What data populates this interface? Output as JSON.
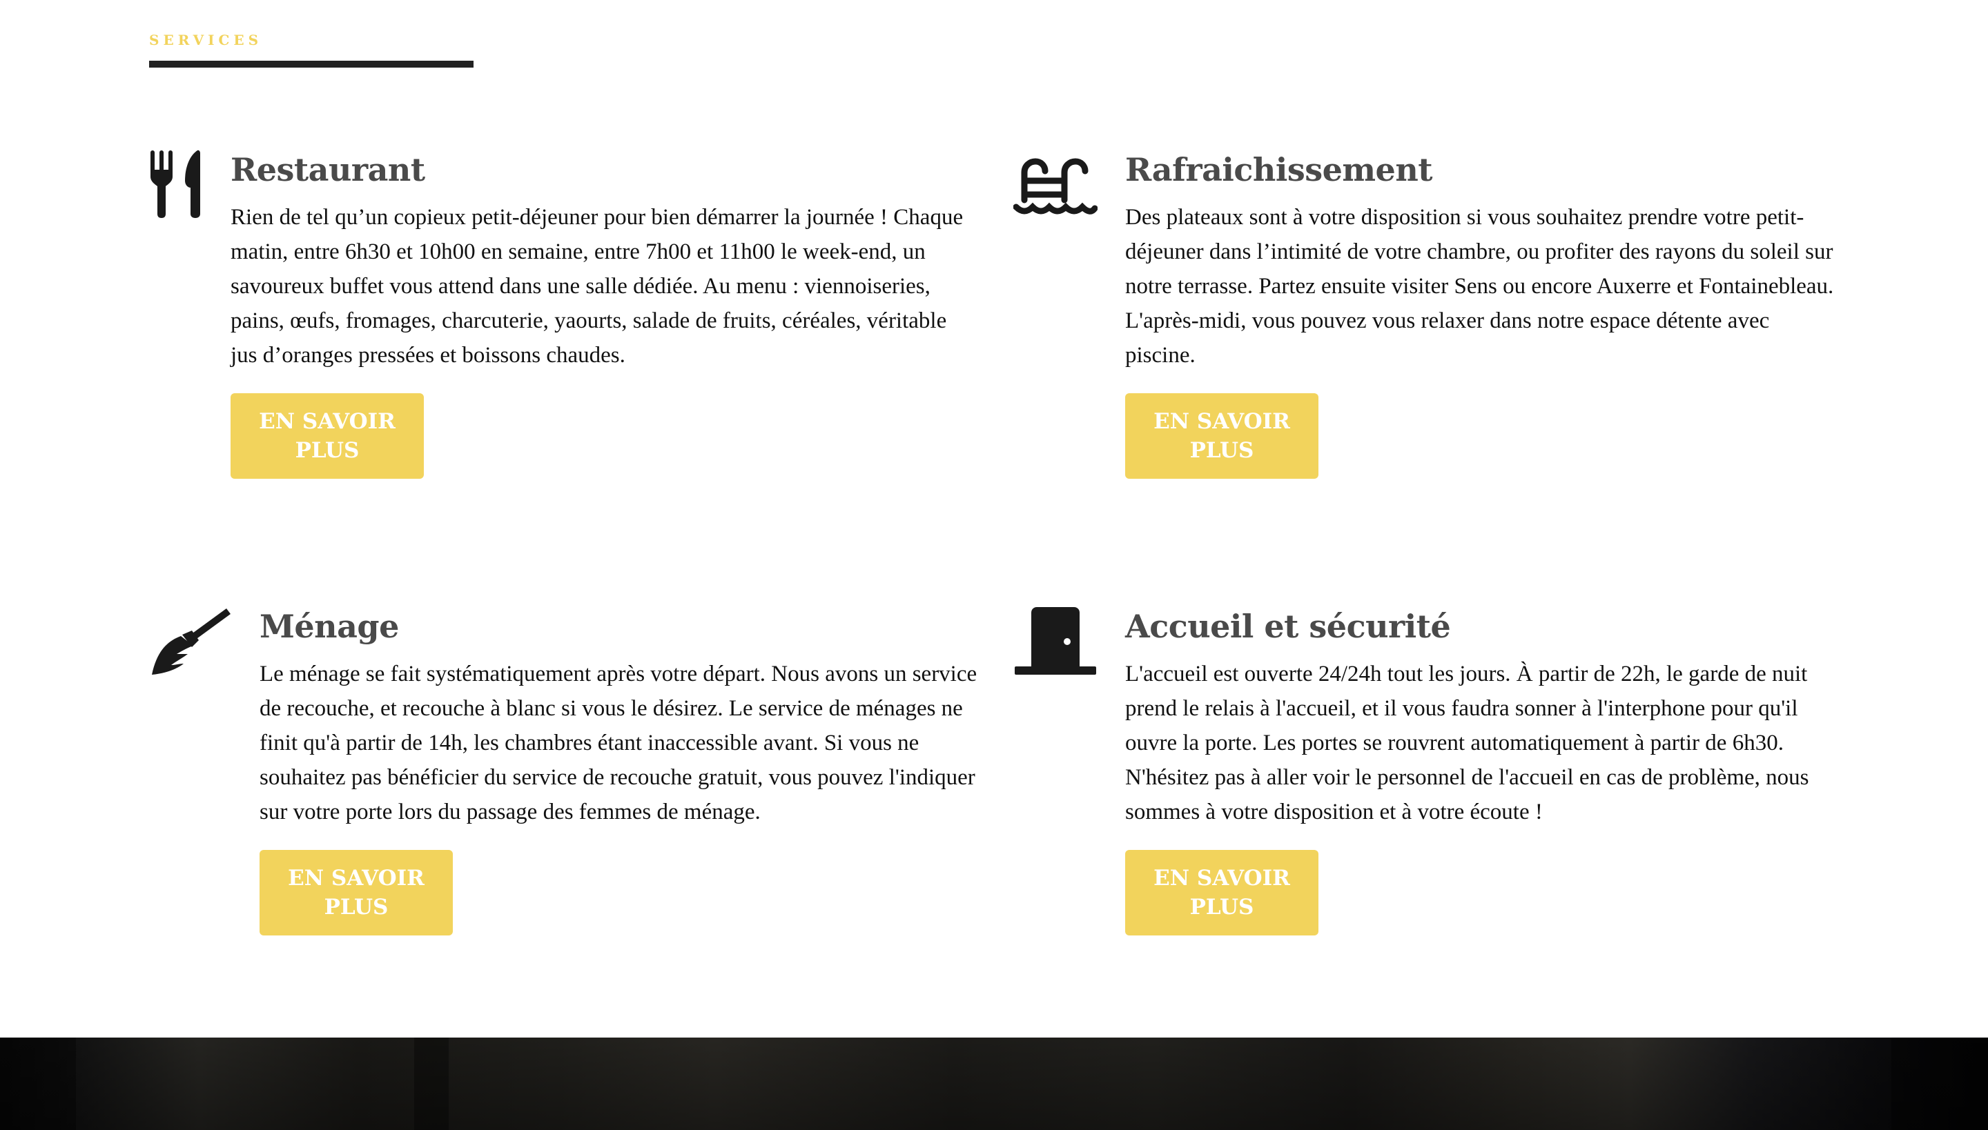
{
  "section": {
    "label": "SERVICES"
  },
  "services": [
    {
      "icon": "utensils-icon",
      "title": "Restaurant",
      "text": "Rien de tel qu’un copieux petit-déjeuner pour bien démarrer la journée ! Chaque matin, entre 6h30 et 10h00 en semaine, entre 7h00 et 11h00 le week-end, un savoureux buffet vous attend dans une salle dédiée. Au menu : viennoiseries, pains, œufs, fromages, charcuterie, yaourts, salade de fruits, céréales, véritable jus d’oranges pressées et boissons chaudes.",
      "button": "EN SAVOIR PLUS"
    },
    {
      "icon": "swimming-pool-icon",
      "title": "Rafraichissement",
      "text": "Des plateaux sont à votre disposition si vous souhaitez prendre votre petit-déjeuner dans l’intimité de votre chambre, ou profiter des rayons du soleil sur notre terrasse. Partez ensuite visiter Sens ou encore Auxerre et Fontainebleau. L'après-midi, vous pouvez vous relaxer dans notre espace détente avec piscine.",
      "button": "EN SAVOIR PLUS"
    },
    {
      "icon": "broom-icon",
      "title": "Ménage",
      "text": "Le ménage se fait systématiquement après votre départ. Nous avons un service de recouche, et recouche à blanc si vous le désirez. Le service de ménages ne finit qu'à partir de 14h, les chambres étant inaccessible avant. Si vous ne souhaitez pas bénéficier du service de recouche gratuit, vous pouvez l'indiquer sur votre porte lors du passage des femmes de ménage.",
      "button": "EN SAVOIR PLUS"
    },
    {
      "icon": "door-icon",
      "title": "Accueil et sécurité",
      "text": "L'accueil est ouverte 24/24h tout les jours. À partir de 22h, le garde de nuit prend le relais à l'accueil, et il vous faudra sonner à l'interphone pour qu'il ouvre la porte. Les portes se rouvrent automatiquement à partir de 6h30. N'hésitez pas à aller voir le personnel de l'accueil en cas de problème, nous sommes à votre disposition et à votre écoute !",
      "button": "EN SAVOIR PLUS"
    }
  ],
  "colors": {
    "accent": "#f2d35c",
    "heading": "#4a4a4a",
    "text": "#111111",
    "icon": "#1a1a1a",
    "underline": "#222222"
  }
}
